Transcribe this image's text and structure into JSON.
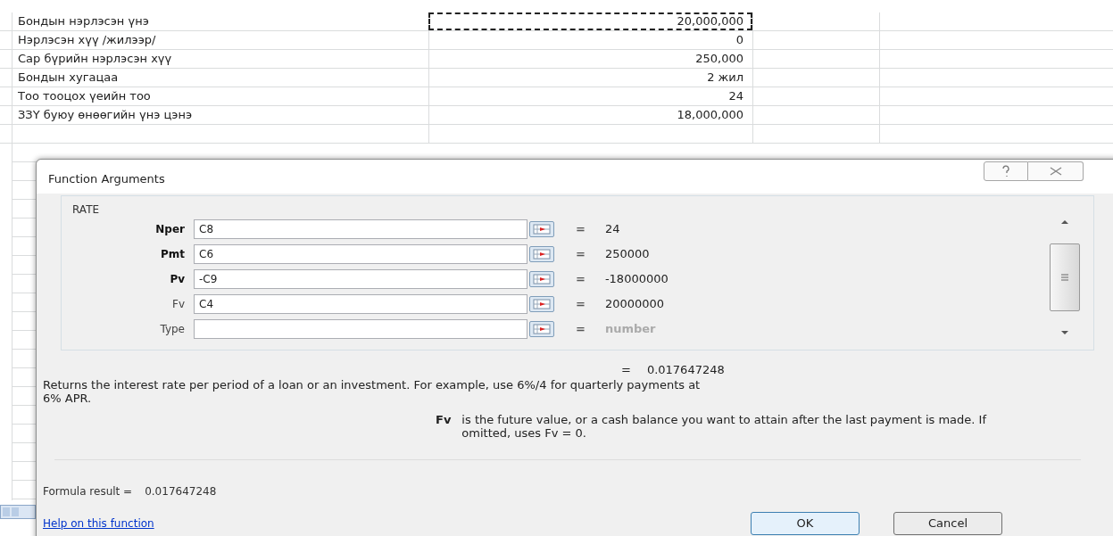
{
  "sheet": {
    "rows": [
      {
        "label": "Бондын нэрлэсэн үнэ",
        "value": "20,000,000",
        "copied": true
      },
      {
        "label": "Нэрлэсэн хүү /жилээр/",
        "value": "0",
        "copied": false
      },
      {
        "label": "Сар бүрийн нэрлэсэн хүү",
        "value": "250,000",
        "copied": false
      },
      {
        "label": "Бондын хугацаа",
        "value": "2 жил",
        "copied": false
      },
      {
        "label": "Тоо тооцох үеийн тоо",
        "value": "24",
        "copied": false
      },
      {
        "label": "ЗЗҮ буюу өнөөгийн үнэ цэнэ",
        "value": "18,000,000",
        "copied": false
      }
    ]
  },
  "dialog": {
    "title": "Function Arguments",
    "function_name": "RATE",
    "args": [
      {
        "name": "Nper",
        "required": true,
        "value": "C8",
        "result": "24",
        "hint": false
      },
      {
        "name": "Pmt",
        "required": true,
        "value": "C6",
        "result": "250000",
        "hint": false
      },
      {
        "name": "Pv",
        "required": true,
        "value": "-C9",
        "result": "-18000000",
        "hint": false
      },
      {
        "name": "Fv",
        "required": false,
        "value": "C4",
        "result": "20000000",
        "hint": false
      },
      {
        "name": "Type",
        "required": false,
        "result": "number",
        "hint": true
      }
    ],
    "equals": "=",
    "total": "0.017647248",
    "description": "Returns the interest rate per period of a loan or an investment. For example, use 6%/4 for quarterly payments at 6% APR.",
    "arg_name": "Fv",
    "arg_help": "is the future value, or a cash balance you want to attain after the last payment is made. If omitted, uses Fv = 0.",
    "formula_label": "Formula result =",
    "formula_value": "0.017647248",
    "help_link": "Help on this function",
    "ok": "OK",
    "cancel": "Cancel"
  }
}
